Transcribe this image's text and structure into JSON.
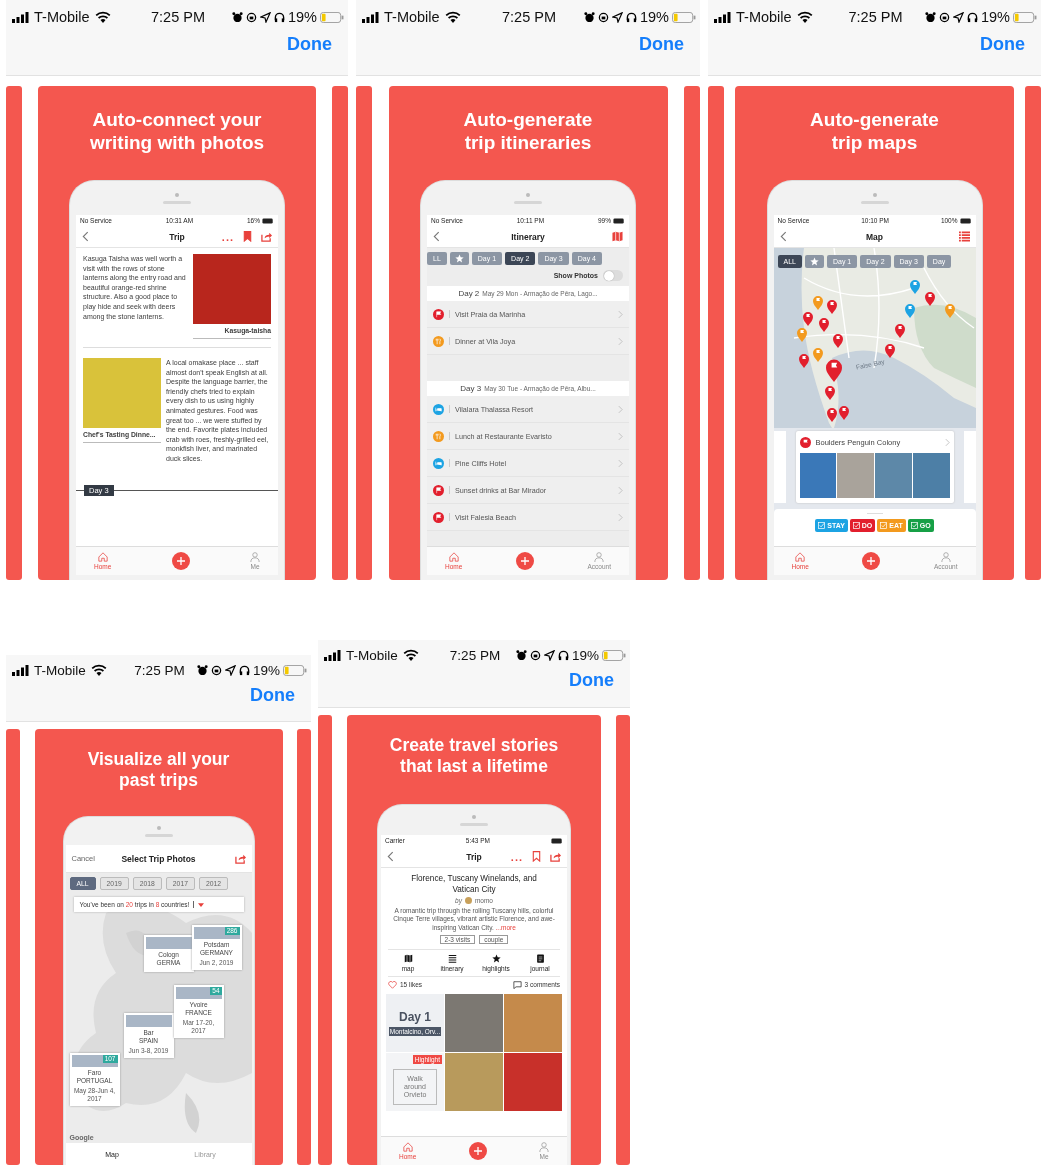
{
  "screens": [
    {
      "kind": "journal",
      "status_bar": {
        "carrier": "T-Mobile",
        "time": "7:25 PM",
        "battery": "19%"
      },
      "done": "Done",
      "headline": "Auto-connect your writing with photos",
      "phone": {
        "status_bar": {
          "carrier": "No Service",
          "time": "10:31 AM",
          "battery": "16%"
        },
        "title": "Trip",
        "more": "...",
        "entries": [
          {
            "text": "Kasuga Taisha was well worth a visit with the rows of stone lanterns along the entry road and beautiful orange-red shrine structure. Also a good place to play hide and seek with deers among the stone lanterns.",
            "caption": "Kasuga-taisha"
          },
          {
            "text": "A local omakase place ... staff almost don't speak English at all. Despite the language barrier, the friendly chefs tried to explain every dish to us using highly animated gestures. Food was great too ... we were stuffed by the end. Favorite plates included crab with roes, freshly-grilled eel, monkfish liver, and marinated duck slices.",
            "caption": "Chef's Tasting Dinne..."
          }
        ],
        "day_marker": "Day 3",
        "tab_bar": [
          {
            "label": "Home",
            "selected": true
          },
          {
            "label": "Me",
            "selected": false
          }
        ]
      }
    },
    {
      "kind": "itinerary",
      "status_bar": {
        "carrier": "T-Mobile",
        "time": "7:25 PM",
        "battery": "19%"
      },
      "done": "Done",
      "headline": "Auto-generate trip itineraries",
      "phone": {
        "status_bar": {
          "carrier": "No Service",
          "time": "10:11 PM",
          "battery": "99%"
        },
        "title": "Itinerary",
        "chips": [
          {
            "kind": "text",
            "label": "LL",
            "selected": false
          },
          {
            "kind": "star",
            "selected": false
          },
          {
            "kind": "text",
            "label": "Day 1",
            "selected": false
          },
          {
            "kind": "text",
            "label": "Day 2",
            "selected": true
          },
          {
            "kind": "text",
            "label": "Day 3",
            "selected": false
          },
          {
            "kind": "text",
            "label": "Day 4",
            "selected": false
          }
        ],
        "toggle": {
          "label": "Show Photos",
          "on": false
        },
        "sections": [
          {
            "day": "Day 2",
            "detail": "May 29 Mon - Armação de Pêra, Lago...",
            "items": [
              {
                "kind": "do",
                "label": "Visit Praia da Marinha"
              },
              {
                "kind": "eat",
                "label": "Dinner at Vila Joya"
              }
            ]
          },
          {
            "day": "Day 3",
            "detail": "May 30 Tue - Armação de Pêra, Albu...",
            "items": [
              {
                "kind": "stay",
                "label": "Vilalara Thalassa Resort"
              },
              {
                "kind": "eat",
                "label": "Lunch at Restaurante Evaristo"
              },
              {
                "kind": "stay",
                "label": "Pine Cliffs Hotel"
              },
              {
                "kind": "do",
                "label": "Sunset drinks at Bar Mirador"
              },
              {
                "kind": "do",
                "label": "Visit Falesia Beach"
              }
            ]
          }
        ],
        "tab_bar": [
          {
            "label": "Home",
            "selected": true
          },
          {
            "label": "Account",
            "selected": false
          }
        ]
      }
    },
    {
      "kind": "map",
      "status_bar": {
        "carrier": "T-Mobile",
        "time": "7:25 PM",
        "battery": "19%"
      },
      "done": "Done",
      "headline": "Auto-generate trip maps",
      "phone": {
        "status_bar": {
          "carrier": "No Service",
          "time": "10:10 PM",
          "battery": "100%"
        },
        "title": "Map",
        "chips": [
          {
            "kind": "text",
            "label": "ALL",
            "selected": true
          },
          {
            "kind": "star",
            "selected": false
          },
          {
            "kind": "text",
            "label": "Day 1",
            "selected": false
          },
          {
            "kind": "text",
            "label": "Day 2",
            "selected": false
          },
          {
            "kind": "text",
            "label": "Day 3",
            "selected": false
          },
          {
            "kind": "text",
            "label": "Day",
            "selected": false
          }
        ],
        "map_label": "False Bay",
        "place": {
          "kind": "do",
          "name": "Boulders Penguin Colony"
        },
        "filters": [
          {
            "kind": "stay",
            "label": "STAY",
            "checked": true
          },
          {
            "kind": "do",
            "label": "DO",
            "checked": true
          },
          {
            "kind": "eat",
            "label": "EAT",
            "checked": true
          },
          {
            "kind": "go",
            "label": "GO",
            "checked": true
          }
        ],
        "tab_bar": [
          {
            "label": "Home",
            "selected": true
          },
          {
            "label": "Account",
            "selected": false
          }
        ]
      }
    },
    {
      "kind": "past_trips",
      "status_bar": {
        "carrier": "T-Mobile",
        "time": "7:25 PM",
        "battery": "19%"
      },
      "done": "Done",
      "headline": "Visualize all your past trips",
      "phone": {
        "cancel": "Cancel",
        "title": "Select Trip Photos",
        "chips": [
          {
            "label": "ALL",
            "selected": true
          },
          {
            "label": "2019",
            "selected": false
          },
          {
            "label": "2018",
            "selected": false
          },
          {
            "label": "2017",
            "selected": false
          },
          {
            "label": "2012",
            "selected": false
          }
        ],
        "summary": "You've been on **20** trips in **8** countries!",
        "trips": [
          {
            "place": "Cologn",
            "country": "GERMA"
          },
          {
            "place": "Potsdam",
            "country": "GERMANY",
            "dates": "Jun 2, 2019",
            "count": "286"
          },
          {
            "place": "Bar",
            "country": "SPAIN",
            "dates": "Jun 3-8, 2019"
          },
          {
            "place": "Yvoire",
            "country": "FRANCE",
            "dates": "Mar 17-20, 2017",
            "count": "54"
          },
          {
            "place": "Faro",
            "country": "PORTUGAL",
            "dates": "May 28-Jun 4, 2017",
            "count": "107"
          }
        ],
        "map_credit": "Google",
        "tabs": [
          {
            "label": "Map",
            "selected": true
          },
          {
            "label": "Library",
            "selected": false
          }
        ]
      }
    },
    {
      "kind": "story",
      "status_bar": {
        "carrier": "T-Mobile",
        "time": "7:25 PM",
        "battery": "19%"
      },
      "done": "Done",
      "headline": "Create travel stories that last a lifetime",
      "phone": {
        "status_bar": {
          "carrier": "Carrier",
          "time": "5:43 PM"
        },
        "title": "Trip",
        "more": "...",
        "story_title": "Florence, Tuscany Winelands, and Vatican City",
        "byline": "by",
        "author": "momo",
        "description": "A romantic trip through the rolling Tuscany hills, colorful Cinque Terre villages, vibrant artistic Florence,  and awe-inspiring Vatican City.",
        "more_link": "...more",
        "tags": [
          "2-3 visits",
          "couple"
        ],
        "actions": [
          {
            "kind": "map",
            "label": "map"
          },
          {
            "kind": "itinerary",
            "label": "itinerary"
          },
          {
            "kind": "highlights",
            "label": "highlights"
          },
          {
            "kind": "journal",
            "label": "journal"
          }
        ],
        "likes": "15 likes",
        "comments": "3 comments",
        "day_tile": {
          "day": "Day 1",
          "place": "Montalcino, Orv..."
        },
        "highlight_tile": {
          "badge": "Highlight",
          "text": "Walk around Orvieto"
        },
        "tab_bar": [
          {
            "label": "Home",
            "selected": true
          },
          {
            "label": "Me",
            "selected": false
          }
        ]
      }
    }
  ]
}
